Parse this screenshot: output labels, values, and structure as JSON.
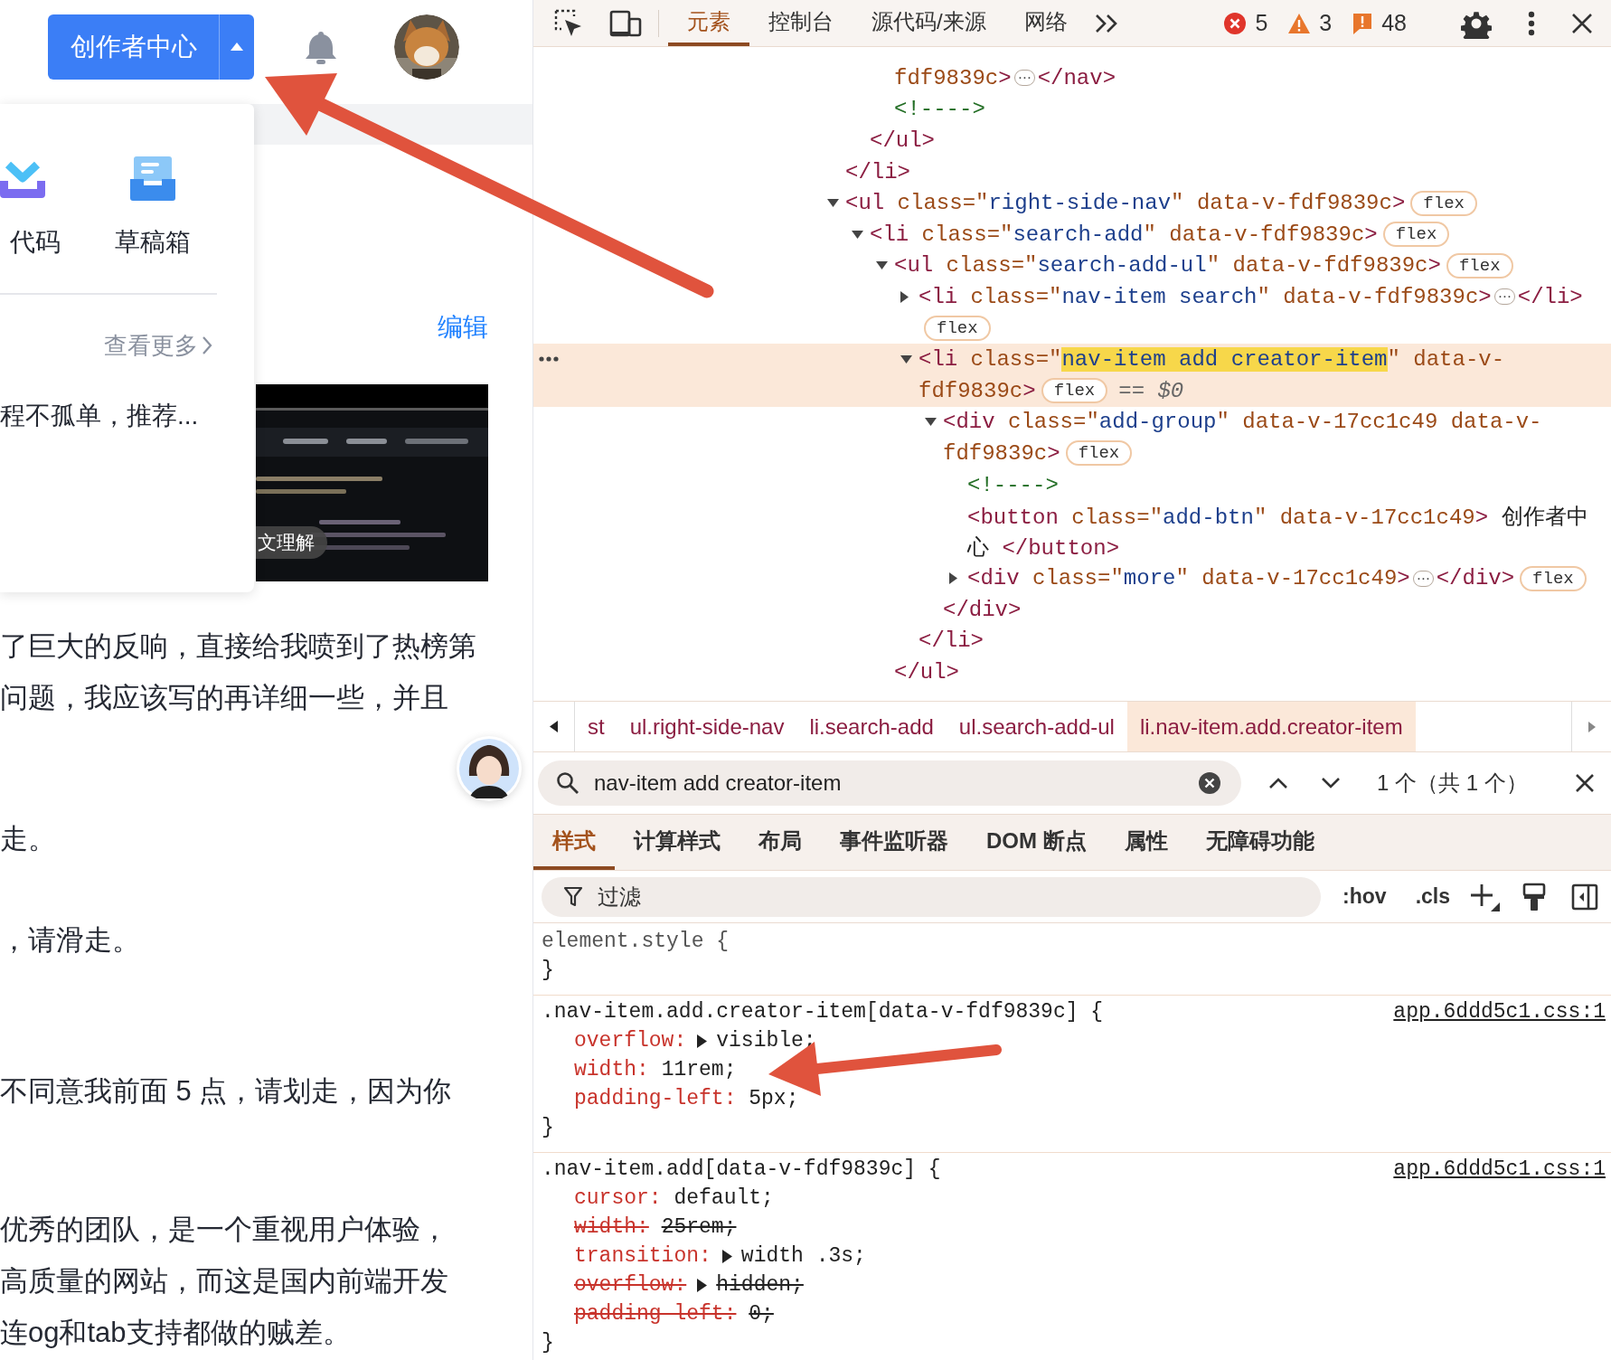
{
  "page": {
    "creator_button": "创作者中心",
    "menu": {
      "items": [
        {
          "kind": "code",
          "label": "代码"
        },
        {
          "kind": "drafts",
          "label": "草稿箱"
        }
      ],
      "more": "查看更多",
      "recent": "程不孤单，推荐..."
    },
    "card": {
      "edit": "编辑",
      "thumbnail": {
        "kind": "picture",
        "chip": "文理解"
      }
    },
    "article": [
      [
        "了巨大的反响，直接给我喷到了热榜第",
        "问题，我应该写的再详细一些，并且"
      ],
      [
        "走。"
      ],
      [
        "，请滑走。"
      ],
      [
        "不同意我前面 5 点，请划走，因为你"
      ],
      [
        "优秀的团队，是一个重视用户体验，",
        "高质量的网站，而这是国内前端开发",
        "连og和tab支持都做的贼差。"
      ]
    ]
  },
  "devtools": {
    "tabs": [
      {
        "label": "元素",
        "selected": true
      },
      {
        "label": "控制台",
        "selected": false
      },
      {
        "label": "源代码/来源",
        "selected": false
      },
      {
        "label": "网络",
        "selected": false
      }
    ],
    "counters": [
      {
        "kind": "error",
        "count": "5"
      },
      {
        "kind": "warning",
        "count": "3"
      },
      {
        "kind": "issue",
        "count": "48"
      }
    ],
    "dom_tree": [
      {
        "selected": false,
        "close": "</li>",
        "children": [
          {
            "selected": false,
            "close": "</ul>",
            "children": [
              {
                "selected": false,
                "lines": [
                  [
                    {
                      "kind": "attr",
                      "text": "fdf9839c"
                    },
                    {
                      "kind": "tag",
                      "text": ">"
                    },
                    {
                      "kind": "ellipsis",
                      "text": "⋯"
                    },
                    {
                      "kind": "tag",
                      "text": "</nav>"
                    }
                  ]
                ]
              },
              {
                "selected": false,
                "lines": [
                  [
                    {
                      "kind": "comment",
                      "text": "<!---->"
                    }
                  ]
                ]
              }
            ]
          }
        ]
      },
      {
        "selected": false,
        "expanded": true,
        "lines": [
          [
            {
              "kind": "tag",
              "text": "<ul"
            },
            {
              "kind": "attr",
              "text": " class=\""
            },
            {
              "kind": "value",
              "text": "right-side-nav"
            },
            {
              "kind": "attr",
              "text": "\" data-v-fdf9839c"
            },
            {
              "kind": "tag",
              "text": ">"
            },
            {
              "kind": "badge",
              "text": "flex"
            }
          ]
        ],
        "children": [
          {
            "selected": false,
            "expanded": true,
            "lines": [
              [
                {
                  "kind": "tag",
                  "text": "<li"
                },
                {
                  "kind": "attr",
                  "text": " class=\""
                },
                {
                  "kind": "value",
                  "text": "search-add"
                },
                {
                  "kind": "attr",
                  "text": "\" data-v-fdf9839c"
                },
                {
                  "kind": "tag",
                  "text": ">"
                },
                {
                  "kind": "badge",
                  "text": "flex"
                }
              ]
            ],
            "children": [
              {
                "selected": false,
                "expanded": true,
                "close": "</ul>",
                "lines": [
                  [
                    {
                      "kind": "tag",
                      "text": "<ul"
                    },
                    {
                      "kind": "attr",
                      "text": " class=\""
                    },
                    {
                      "kind": "value",
                      "text": "search-add-ul"
                    },
                    {
                      "kind": "attr",
                      "text": "\" data-v-fdf9839c"
                    },
                    {
                      "kind": "tag",
                      "text": ">"
                    },
                    {
                      "kind": "badge",
                      "text": "flex"
                    }
                  ]
                ],
                "children": [
                  {
                    "selected": false,
                    "expanded": false,
                    "lines": [
                      [
                        {
                          "kind": "tag",
                          "text": "<li"
                        },
                        {
                          "kind": "attr",
                          "text": " class=\""
                        },
                        {
                          "kind": "value",
                          "text": "nav-item search"
                        },
                        {
                          "kind": "attr",
                          "text": "\" data-v-fdf9839c"
                        },
                        {
                          "kind": "tag",
                          "text": ">"
                        },
                        {
                          "kind": "ellipsis",
                          "text": "⋯"
                        },
                        {
                          "kind": "tag",
                          "text": "</li>"
                        }
                      ],
                      [
                        {
                          "kind": "badge",
                          "text": "flex"
                        }
                      ]
                    ]
                  },
                  {
                    "selected": true,
                    "expanded": true,
                    "close": "</li>",
                    "lines": [
                      [
                        {
                          "kind": "tag",
                          "text": "<li"
                        },
                        {
                          "kind": "attr",
                          "text": " class=\""
                        },
                        {
                          "kind": "match",
                          "text": "nav-item add creator-item"
                        },
                        {
                          "kind": "attr",
                          "text": "\" data-v-"
                        }
                      ],
                      [
                        {
                          "kind": "attr",
                          "text": "fdf9839c"
                        },
                        {
                          "kind": "tag",
                          "text": ">"
                        },
                        {
                          "kind": "badge",
                          "text": "flex"
                        },
                        {
                          "kind": "dollar",
                          "text": "== $0"
                        }
                      ]
                    ],
                    "children": [
                      {
                        "selected": false,
                        "expanded": true,
                        "close": "</div>",
                        "lines": [
                          [
                            {
                              "kind": "tag",
                              "text": "<div"
                            },
                            {
                              "kind": "attr",
                              "text": " class=\""
                            },
                            {
                              "kind": "value",
                              "text": "add-group"
                            },
                            {
                              "kind": "attr",
                              "text": "\" data-v-17cc1c49 data-v-"
                            }
                          ],
                          [
                            {
                              "kind": "attr",
                              "text": "fdf9839c"
                            },
                            {
                              "kind": "tag",
                              "text": ">"
                            },
                            {
                              "kind": "badge",
                              "text": "flex"
                            }
                          ]
                        ],
                        "children": [
                          {
                            "selected": false,
                            "lines": [
                              [
                                {
                                  "kind": "comment",
                                  "text": "<!---->"
                                }
                              ]
                            ]
                          },
                          {
                            "selected": false,
                            "lines": [
                              [
                                {
                                  "kind": "tag",
                                  "text": "<button"
                                },
                                {
                                  "kind": "attr",
                                  "text": " class=\""
                                },
                                {
                                  "kind": "value",
                                  "text": "add-btn"
                                },
                                {
                                  "kind": "attr",
                                  "text": "\" data-v-17cc1c49"
                                },
                                {
                                  "kind": "tag",
                                  "text": ">"
                                },
                                {
                                  "kind": "text",
                                  "text": " 创作者中"
                                }
                              ],
                              [
                                {
                                  "kind": "text",
                                  "text": "心 "
                                },
                                {
                                  "kind": "tag",
                                  "text": "</button>"
                                }
                              ]
                            ]
                          },
                          {
                            "selected": false,
                            "expanded": false,
                            "lines": [
                              [
                                {
                                  "kind": "tag",
                                  "text": "<div"
                                },
                                {
                                  "kind": "attr",
                                  "text": " class=\""
                                },
                                {
                                  "kind": "value",
                                  "text": "more"
                                },
                                {
                                  "kind": "attr",
                                  "text": "\" data-v-17cc1c49"
                                },
                                {
                                  "kind": "tag",
                                  "text": ">"
                                },
                                {
                                  "kind": "ellipsis",
                                  "text": "⋯"
                                },
                                {
                                  "kind": "tag",
                                  "text": "</div>"
                                },
                                {
                                  "kind": "badge",
                                  "text": "flex"
                                }
                              ]
                            ]
                          }
                        ]
                      }
                    ]
                  }
                ]
              }
            ]
          }
        ]
      }
    ],
    "breadcrumbs": [
      {
        "label": "st",
        "selected": false
      },
      {
        "label": "ul.right-side-nav",
        "selected": false
      },
      {
        "label": "li.search-add",
        "selected": false
      },
      {
        "label": "ul.search-add-ul",
        "selected": false
      },
      {
        "label": "li.nav-item.add.creator-item",
        "selected": true
      }
    ],
    "search": {
      "value": "nav-item add creator-item",
      "result": "1 个（共 1 个）"
    },
    "pane_tabs": [
      {
        "label": "样式",
        "selected": true
      },
      {
        "label": "计算样式",
        "selected": false
      },
      {
        "label": "布局",
        "selected": false
      },
      {
        "label": "事件监听器",
        "selected": false
      },
      {
        "label": "DOM 断点",
        "selected": false
      },
      {
        "label": "属性",
        "selected": false
      },
      {
        "label": "无障碍功能",
        "selected": false
      }
    ],
    "filter": {
      "placeholder": "过滤"
    },
    "style_buttons": [
      ":hov",
      ".cls"
    ],
    "rules": [
      {
        "kind": "inline",
        "selector": "element.style {",
        "close": "}"
      },
      {
        "kind": "stylesheet",
        "selector": ".nav-item.add.creator-item[data-v-fdf9839c] {",
        "source": "app.6ddd5c1.css:1",
        "close": "}",
        "declarations": [
          {
            "property": "overflow:",
            "value": "visible;",
            "expandable": true,
            "overridden": false
          },
          {
            "property": "width:",
            "value": "11rem;",
            "expandable": false,
            "overridden": false
          },
          {
            "property": "padding-left:",
            "value": "5px;",
            "expandable": false,
            "overridden": false
          }
        ]
      },
      {
        "kind": "stylesheet",
        "selector": ".nav-item.add[data-v-fdf9839c] {",
        "source": "app.6ddd5c1.css:1",
        "close": "}",
        "declarations": [
          {
            "property": "cursor:",
            "value": "default;",
            "expandable": false,
            "overridden": false
          },
          {
            "property": "width:",
            "value": "25rem;",
            "expandable": false,
            "overridden": true
          },
          {
            "property": "transition:",
            "value": "width .3s;",
            "expandable": true,
            "overridden": false
          },
          {
            "property": "overflow:",
            "value": "hidden;",
            "expandable": true,
            "overridden": true
          },
          {
            "property": "padding-left:",
            "value": "0;",
            "expandable": false,
            "overridden": true
          }
        ]
      }
    ]
  }
}
